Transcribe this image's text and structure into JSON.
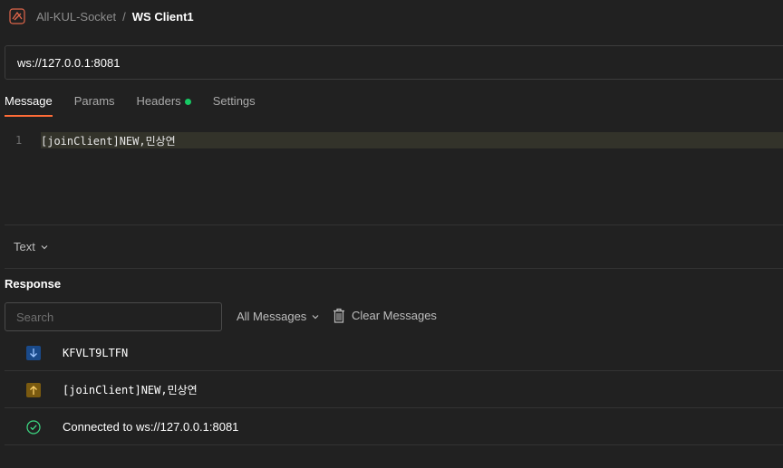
{
  "breadcrumb": {
    "parent": "All-KUL-Socket",
    "separator": "/",
    "current": "WS Client1"
  },
  "url": {
    "value": "ws://127.0.0.1:8081"
  },
  "tabs": [
    {
      "label": "Message",
      "active": true
    },
    {
      "label": "Params",
      "active": false
    },
    {
      "label": "Headers",
      "active": false
    },
    {
      "label": "Settings",
      "active": false
    }
  ],
  "editor": {
    "line_number": "1",
    "content": "[joinClient]NEW,민상연"
  },
  "format": {
    "selected": "Text"
  },
  "response": {
    "title": "Response",
    "search_placeholder": "Search",
    "filter_selected": "All Messages",
    "clear_label": "Clear Messages",
    "messages": [
      {
        "direction": "incoming",
        "icon": "arrow-down-icon",
        "text": "KFVLT9LTFN"
      },
      {
        "direction": "outgoing",
        "icon": "arrow-up-icon",
        "text": "[joinClient]NEW,민상연"
      },
      {
        "direction": "status",
        "icon": "check-circle-icon",
        "text": "Connected to ws://127.0.0.1:8081"
      }
    ]
  },
  "colors": {
    "accent": "#ff6c37",
    "status_dot": "#17c964",
    "background": "#212121"
  }
}
